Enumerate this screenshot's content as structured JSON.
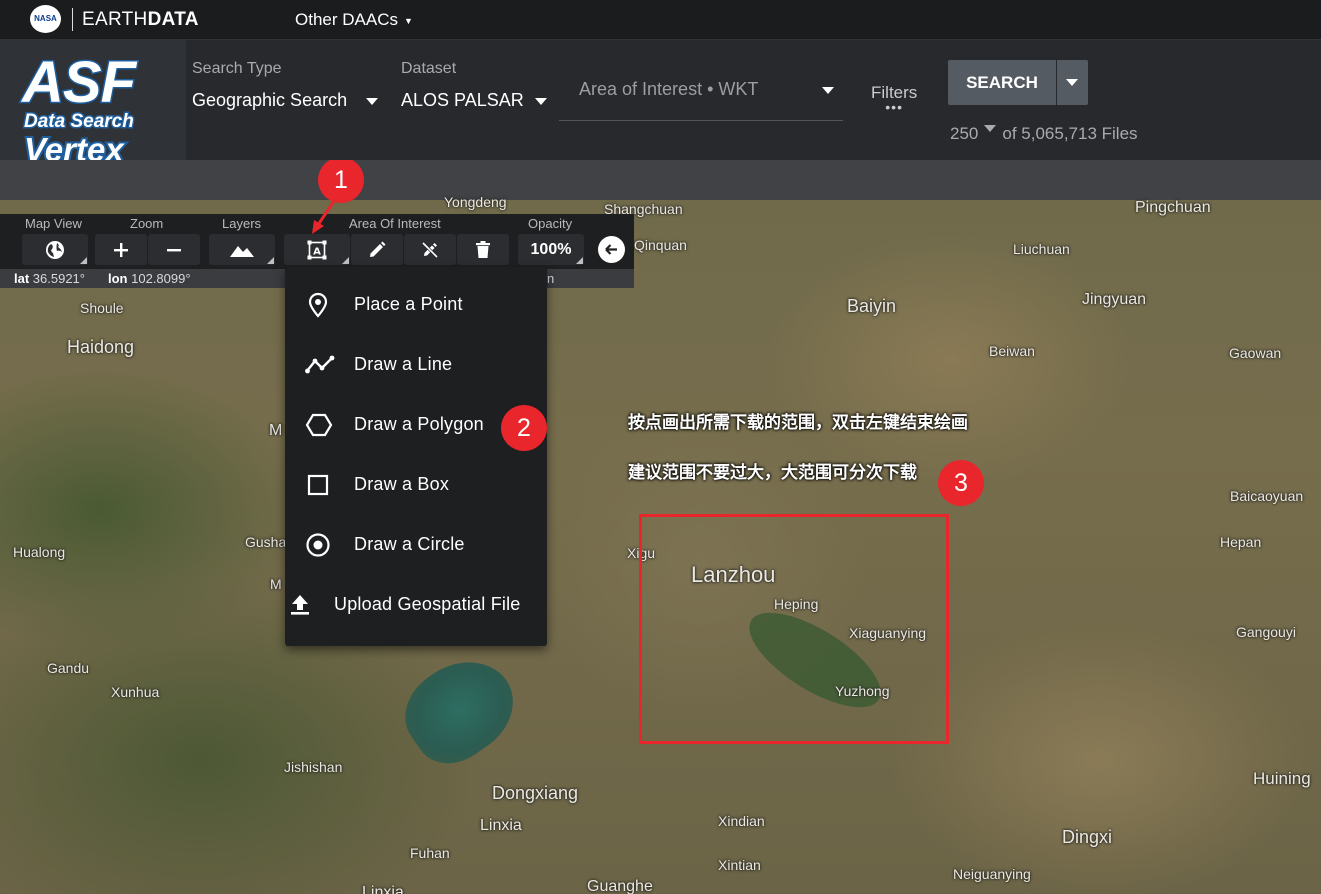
{
  "earthdata_bar": {
    "nasa_logo": "NASA",
    "brand_light": "EARTH",
    "brand_bold": "DATA",
    "other_daacs": "Other DAACs"
  },
  "asf_logo": {
    "line1": "ASF",
    "line2": "Data Search",
    "line3": "Vertex"
  },
  "search_controls": {
    "search_type_label": "Search Type",
    "search_type_value": "Geographic Search",
    "dataset_label": "Dataset",
    "dataset_value": "ALOS PALSAR",
    "aoi_placeholder": "Area of Interest • WKT",
    "filters_label": "Filters",
    "filters_dots": "•••",
    "search_button": "SEARCH",
    "max_results": "250",
    "results_suffix": "of 5,065,713 Files"
  },
  "map_toolbar": {
    "map_view_label": "Map View",
    "zoom_label": "Zoom",
    "layers_label": "Layers",
    "aoi_label": "Area Of Interest",
    "opacity_label": "Opacity",
    "opacity_value": "100%",
    "lat_label": "lat",
    "lat_value": "36.5921°",
    "lon_label": "lon",
    "lon_value": "102.8099°",
    "hidden_text": "n"
  },
  "aoi_menu": {
    "items": [
      {
        "label": "Place a Point",
        "icon": "map-marker-icon"
      },
      {
        "label": "Draw a Line",
        "icon": "polyline-icon"
      },
      {
        "label": "Draw a Polygon",
        "icon": "hexagon-icon"
      },
      {
        "label": "Draw a Box",
        "icon": "square-icon"
      },
      {
        "label": "Draw a Circle",
        "icon": "circle-dot-icon"
      },
      {
        "label": "Upload Geospatial File",
        "icon": "upload-icon"
      }
    ]
  },
  "annotations": {
    "badge1": "1",
    "badge2": "2",
    "badge3": "3",
    "instruction1": "按点画出所需下载的范围，双击左键结束绘画",
    "instruction2": "建议范围不要过大，大范围可分次下载",
    "color": "#e8262b"
  },
  "map_places": {
    "yongdeng": "Yongdeng",
    "shangchuan": "Shangchuan",
    "pingchuan": "Pingchuan",
    "qinquan": "Qinquan",
    "liuchuan": "Liuchuan",
    "shoule": "Shoule",
    "baiyin": "Baiyin",
    "jingyuan": "Jingyuan",
    "haidong": "Haidong",
    "beiwan": "Beiwan",
    "gaowan": "Gaowan",
    "m1": "M",
    "baicaoyuan": "Baicaoyuan",
    "hualong": "Hualong",
    "gusha": "Gusha",
    "xigu": "Xigu",
    "hepan": "Hepan",
    "lanzhou": "Lanzhou",
    "m2": "M",
    "heping": "Heping",
    "xiaguanying": "Xiaguanying",
    "gangouyi": "Gangouyi",
    "gandu": "Gandu",
    "xunhua": "Xunhua",
    "yuzhong": "Yuzhong",
    "jishishan": "Jishishan",
    "huining": "Huining",
    "dongxiang": "Dongxiang",
    "linxia": "Linxia",
    "xindian": "Xindian",
    "dingxi": "Dingxi",
    "fuhan": "Fuhan",
    "xintian": "Xintian",
    "neiguanying": "Neiguanying",
    "linxia2": "Linxia",
    "guanghe": "Guanghe"
  },
  "colors": {
    "header": "#27292c",
    "toolbar": "#1e1f21",
    "search_button": "#545b63",
    "logo_blue": "#1f5f9e"
  }
}
